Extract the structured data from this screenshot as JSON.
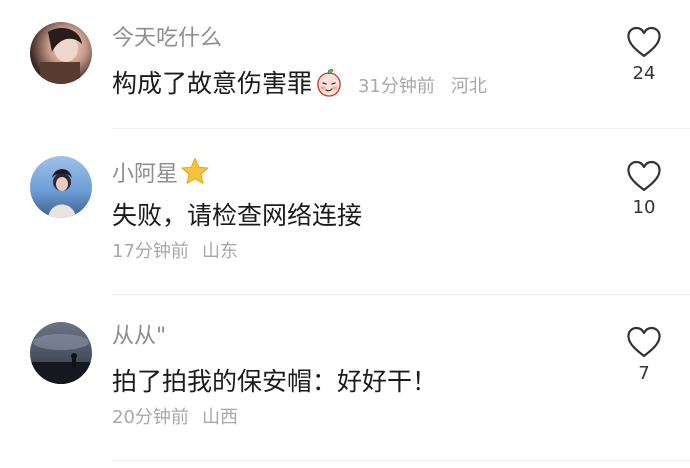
{
  "comments": [
    {
      "username": "今天吃什么",
      "text": "构成了故意伤害罪",
      "sticker": "peach-smirk-emoji",
      "time": "31分钟前",
      "location": "河北",
      "likes": "24"
    },
    {
      "username": "小阿星",
      "badge": "star-icon",
      "text": "失败，请检查网络连接",
      "time": "17分钟前",
      "location": "山东",
      "likes": "10"
    },
    {
      "username": "从从\"",
      "text": "拍了拍我的保安帽：好好干！",
      "time": "20分钟前",
      "location": "山西",
      "likes": "7"
    }
  ],
  "colors": {
    "username": "#8f8f8f",
    "meta": "#a8a8a8",
    "star": "#f5c33b",
    "heart_outline": "#333333"
  }
}
